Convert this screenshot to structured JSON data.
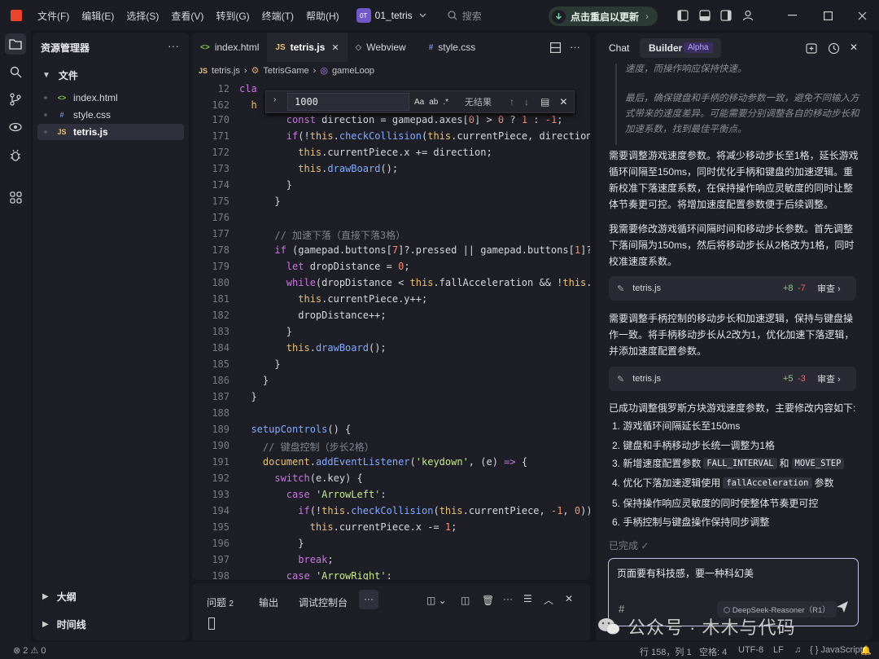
{
  "menu": [
    "文件(F)",
    "编辑(E)",
    "选择(S)",
    "查看(V)",
    "转到(G)",
    "终端(T)",
    "帮助(H)"
  ],
  "project": {
    "badge": "0T",
    "name": "01_tetris"
  },
  "search": {
    "label": "搜索"
  },
  "restart": {
    "label": "点击重启以更新"
  },
  "explorer": {
    "title": "资源管理器",
    "section": "文件",
    "files": [
      {
        "name": "index.html",
        "icon": "<>",
        "color": "#8bc34a"
      },
      {
        "name": "style.css",
        "icon": "#",
        "color": "#7b8ed8"
      },
      {
        "name": "tetris.js",
        "icon": "JS",
        "color": "#e5c07b"
      }
    ],
    "outline": "大纲",
    "timeline": "时间线"
  },
  "tabs": [
    {
      "label": "index.html",
      "icon": "<>",
      "color": "#8bc34a"
    },
    {
      "label": "tetris.js",
      "icon": "JS",
      "color": "#e5c07b"
    },
    {
      "label": "Webview",
      "icon": "◇",
      "color": "#cccccc"
    },
    {
      "label": "style.css",
      "icon": "#",
      "color": "#7b8ed8"
    }
  ],
  "breadcrumb": {
    "file": "tetris.js",
    "cls": "TetrisGame",
    "method": "gameLoop"
  },
  "find": {
    "value": "1000",
    "result": "无结果"
  },
  "code": {
    "lines": [
      {
        "n": "12",
        "html": "<span class='kw'>cla</span>"
      },
      {
        "n": "162",
        "html": "  <span class='th'>h</span>"
      },
      {
        "n": "170",
        "html": "        <span class='kw'>const</span> direction = gamepad.axes[<span class='nm'>0</span>] > <span class='nm'>0</span> ? <span class='nm'>1</span> : <span class='nm'>-1</span>;"
      },
      {
        "n": "171",
        "html": "        <span class='kw'>if</span>(!<span class='th'>this</span>.<span class='fn'>checkCollision</span>(<span class='th'>this</span>.currentPiece, direction"
      },
      {
        "n": "172",
        "html": "          <span class='th'>this</span>.currentPiece.x += direction;"
      },
      {
        "n": "173",
        "html": "          <span class='th'>this</span>.<span class='fn'>drawBoard</span>();"
      },
      {
        "n": "174",
        "html": "        }"
      },
      {
        "n": "175",
        "html": "      }"
      },
      {
        "n": "176",
        "html": ""
      },
      {
        "n": "177",
        "html": "      <span class='cm'>// 加速下落（直接下落3格）</span>"
      },
      {
        "n": "178",
        "html": "      <span class='kw'>if</span> (gamepad.buttons[<span class='nm'>7</span>]?.pressed || gamepad.buttons[<span class='nm'>1</span>]?"
      },
      {
        "n": "179",
        "html": "        <span class='kw'>let</span> dropDistance = <span class='nm'>0</span>;"
      },
      {
        "n": "180",
        "html": "        <span class='kw'>while</span>(dropDistance < <span class='th'>this</span>.fallAcceleration && !<span class='th'>this</span>."
      },
      {
        "n": "181",
        "html": "          <span class='th'>this</span>.currentPiece.y++;"
      },
      {
        "n": "182",
        "html": "          dropDistance++;"
      },
      {
        "n": "183",
        "html": "        }"
      },
      {
        "n": "184",
        "html": "        <span class='th'>this</span>.<span class='fn'>drawBoard</span>();"
      },
      {
        "n": "185",
        "html": "      }"
      },
      {
        "n": "186",
        "html": "    }"
      },
      {
        "n": "187",
        "html": "  }"
      },
      {
        "n": "188",
        "html": ""
      },
      {
        "n": "189",
        "html": "  <span class='fn'>setupControls</span>() {"
      },
      {
        "n": "190",
        "html": "    <span class='cm'>// 键盘控制（步长2格）</span>"
      },
      {
        "n": "191",
        "html": "    <span class='th'>document</span>.<span class='fn'>addEventListener</span>(<span class='st'>'keydown'</span>, (e) <span class='kw'>=></span> {"
      },
      {
        "n": "192",
        "html": "      <span class='kw'>switch</span>(e.key) {"
      },
      {
        "n": "193",
        "html": "        <span class='kw'>case</span> <span class='st'>'ArrowLeft'</span>:"
      },
      {
        "n": "194",
        "html": "          <span class='kw'>if</span>(!<span class='th'>this</span>.<span class='fn'>checkCollision</span>(<span class='th'>this</span>.currentPiece, <span class='nm'>-1</span>, <span class='nm'>0</span>))"
      },
      {
        "n": "195",
        "html": "            <span class='th'>this</span>.currentPiece.x -= <span class='nm'>1</span>;"
      },
      {
        "n": "196",
        "html": "          }"
      },
      {
        "n": "197",
        "html": "          <span class='kw'>break</span>;"
      },
      {
        "n": "198",
        "html": "        <span class='kw'>case</span> <span class='st'>'ArrowRight'</span>:"
      }
    ]
  },
  "panel": {
    "tabs": [
      "问题",
      "输出",
      "调试控制台"
    ],
    "problems_count": "2"
  },
  "chat": {
    "tab_chat": "Chat",
    "tab_builder": "Builder",
    "alpha": "Alpha",
    "thinking": [
      "速度，而操作响应保持快速。",
      "最后，确保键盘和手柄的移动参数一致，避免不同输入方式带来的速度差异。可能需要分别调整各自的移动步长和加速系数，找到最佳平衡点。"
    ],
    "p1": "需要调整游戏速度参数。将减少移动步长至1格，延长游戏循环间隔至150ms，同时优化手柄和键盘的加速逻辑。重新校准下落速度系数，在保持操作响应灵敏度的同时让整体节奏更可控。将增加速度配置参数便于后续调整。",
    "p2": "我需要修改游戏循环间隔时间和移动步长参数。首先调整下落间隔为150ms，然后将移动步长从2格改为1格，同时校准速度系数。",
    "card1": {
      "file": "tetris.js",
      "add": "+8",
      "del": "-7",
      "review": "审查"
    },
    "p3": "需要调整手柄控制的移动步长和加速逻辑，保持与键盘操作一致。将手柄移动步长从2改为1，优化加速下落逻辑，并添加速度配置参数。",
    "card2": {
      "file": "tetris.js",
      "add": "+5",
      "del": "-3",
      "review": "审查"
    },
    "summary": "已成功调整俄罗斯方块游戏速度参数，主要修改内容如下:",
    "list": {
      "i1": "1. 游戏循环间隔延长至150ms",
      "i2": "2. 键盘和手柄移动步长统一调整为1格",
      "i3a": "3. 新增速度配置参数",
      "i3b": "FALL_INTERVAL",
      "i3c": "和",
      "i3d": "MOVE_STEP",
      "i4a": "4. 优化下落加速逻辑使用",
      "i4b": "fallAcceleration",
      "i4c": "参数",
      "i5": "5. 保持操作响应灵敏度的同时使整体节奏更可控",
      "i6": "6. 手柄控制与键盘操作保持同步调整"
    },
    "done": "已完成 ✓",
    "input": "页面要有科技感，要一种科幻美",
    "hash": "#",
    "model": "⬡ DeepSeek-Reasoner（R1）"
  },
  "watermark": "公众号 · 木木与代码",
  "status": {
    "errors": "2",
    "warnings": "0",
    "pos": "行 158，列 1",
    "spaces": "空格: 4",
    "enc": "UTF-8",
    "eol": "LF",
    "lang": "{ } JavaScript"
  }
}
